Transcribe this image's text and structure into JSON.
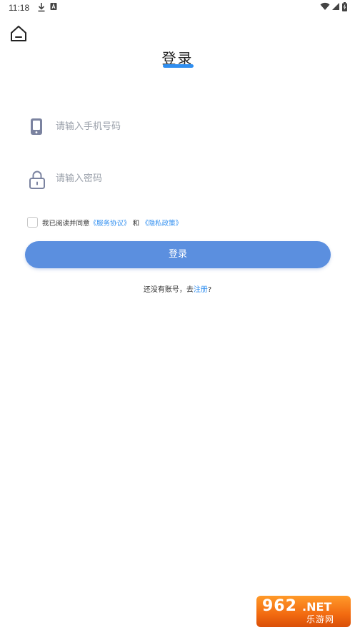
{
  "status_bar": {
    "time": "11:18",
    "left_icons": [
      "download-icon",
      "a-notification-icon"
    ],
    "right_icons": [
      "wifi-icon",
      "signal-icon",
      "battery-icon"
    ]
  },
  "header": {
    "title": "登录",
    "home_icon": "home-icon",
    "accent_color": "#2f8ef0"
  },
  "form": {
    "phone": {
      "placeholder": "请输入手机号码",
      "value": "",
      "icon": "phone-icon"
    },
    "password": {
      "placeholder": "请输入密码",
      "value": "",
      "icon": "lock-icon"
    },
    "agreement": {
      "checked": false,
      "prefix": "我已阅读并同意",
      "service_link": "《服务协议》",
      "conjunction": "和",
      "privacy_link": "《隐私政策》"
    },
    "login_button": {
      "label": "登录",
      "color": "#5b8fdf"
    }
  },
  "register": {
    "prefix": "还没有账号，去",
    "link": "注册",
    "suffix": "?"
  },
  "watermark": {
    "number": "962",
    "net": ".NET",
    "cn": "乐游网"
  }
}
